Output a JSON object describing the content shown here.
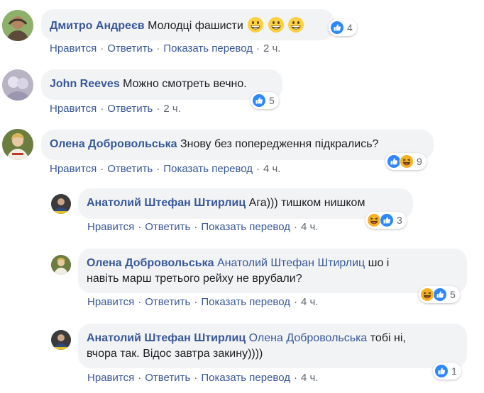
{
  "labels": {
    "like": "Нравится",
    "reply": "Ответить",
    "translate": "Показать перевод",
    "sep": "·"
  },
  "icons": {
    "like": "like-reaction-icon",
    "haha": "haha-reaction-icon",
    "grin": "grinning-emoji-icon"
  },
  "colors": {
    "author": "#385898",
    "bubble": "#f2f3f5",
    "meta": "#606770",
    "like": "#2d88ff",
    "haha": "#f7b125"
  },
  "comments": [
    {
      "author": "Дмитро Андреєв",
      "text": "Молодці фашисти",
      "emoji_count": 3,
      "time": "2 ч.",
      "reactions": [
        "like"
      ],
      "reaction_count": "4"
    },
    {
      "author": "John Reeves",
      "text": "Можно смотреть вечно.",
      "time": "2 ч.",
      "reactions": [
        "like"
      ],
      "reaction_count": "5"
    },
    {
      "author": "Олена Добровольська",
      "text": "Знову без попередження підкрались?",
      "time": "4 ч.",
      "reactions": [
        "like",
        "haha"
      ],
      "reaction_count": "9"
    },
    {
      "author": "Анатолий Штефан Штирлиц",
      "text": "Ага))) тишком нишком",
      "time": "4 ч.",
      "reactions": [
        "haha",
        "like"
      ],
      "reaction_count": "3"
    },
    {
      "author": "Олена Добровольська",
      "mention": "Анатолий Штефан Штирлиц",
      "text_line1": "шо і",
      "text_line2": "навіть марш третього рейху не врубали?",
      "time": "4 ч.",
      "reactions": [
        "haha",
        "like"
      ],
      "reaction_count": "5"
    },
    {
      "author": "Анатолий Штефан Штирлиц",
      "mention": "Олена Добровольська",
      "text_line1": "тобі ні,",
      "text_line2": "вчора так. Відос завтра закину))))",
      "time": "4 ч.",
      "reactions": [
        "like"
      ],
      "reaction_count": "1"
    }
  ]
}
